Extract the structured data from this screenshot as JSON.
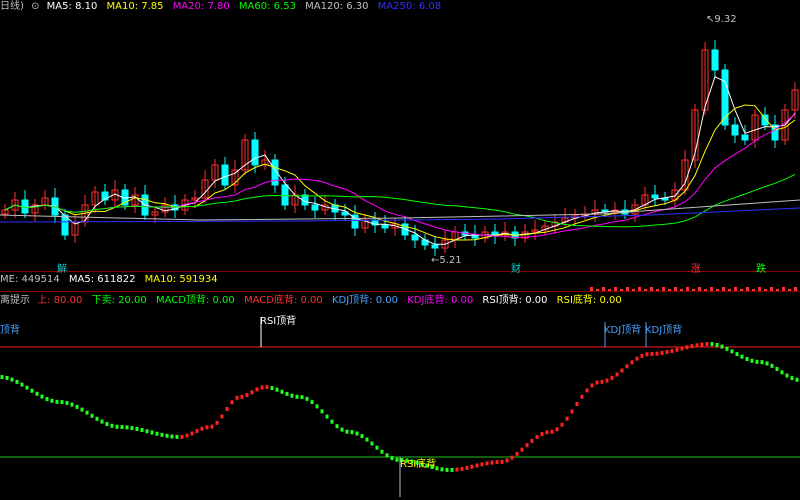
{
  "top_bar": {
    "period": "日线)",
    "ma5_label": "MA5:",
    "ma5_value": "8.10",
    "ma5_color": "#ffffff",
    "ma10_label": "MA10:",
    "ma10_value": "7.85",
    "ma10_color": "#ffff00",
    "ma20_label": "MA20:",
    "ma20_value": "7.80",
    "ma20_color": "#ff00ff",
    "ma60_label": "MA60:",
    "ma60_value": "6.53",
    "ma60_color": "#00ff00",
    "ma120_label": "MA120:",
    "ma120_value": "6.30",
    "ma120_color": "#c0c0c0",
    "ma250_label": "MA250:",
    "ma250_value": "6.08",
    "ma250_color": "#3030ff"
  },
  "price_annotations": {
    "high": "9.32",
    "low": "5.21"
  },
  "event_markers": [
    {
      "text": "解",
      "color": "#00d0d0"
    },
    {
      "text": "财",
      "color": "#00d0d0"
    },
    {
      "text": "涨",
      "color": "#ff3030"
    },
    {
      "text": "跌",
      "color": "#00ff00"
    }
  ],
  "volume_bar": {
    "vol_label": "ME:",
    "vol_value": "449514",
    "ma5_label": "MA5:",
    "ma5_value": "611822",
    "ma10_label": "MA10:",
    "ma10_value": "591934"
  },
  "indicator_bar": {
    "name": "离提示",
    "items": [
      {
        "label": "上:",
        "value": "80.00",
        "color": "#ff3030"
      },
      {
        "label": "下卖:",
        "value": "20.00",
        "color": "#00ff00"
      },
      {
        "label": "MACD顶背:",
        "value": "0.00",
        "color": "#00ff00"
      },
      {
        "label": "MACD底背:",
        "value": "0.00",
        "color": "#ff3030"
      },
      {
        "label": "KDJ顶背:",
        "value": "0.00",
        "color": "#4aa0ff"
      },
      {
        "label": "KDJ底背:",
        "value": "0.00",
        "color": "#ff00ff"
      },
      {
        "label": "RSI顶背:",
        "value": "0.00",
        "color": "#ffffff"
      },
      {
        "label": "RSI底背:",
        "value": "0.00",
        "color": "#ffff00"
      }
    ]
  },
  "signals": {
    "left_top": "顶背",
    "rsi_top": "RSI顶背",
    "kdj_top_1": "KDJ顶背",
    "kdj_top_2": "KDJ顶背",
    "rsi_bottom": "RSI底背"
  },
  "colors": {
    "up": "#ff3030",
    "down": "#00ffff",
    "osc_up": "#ff2020",
    "osc_down": "#20ff20"
  }
}
